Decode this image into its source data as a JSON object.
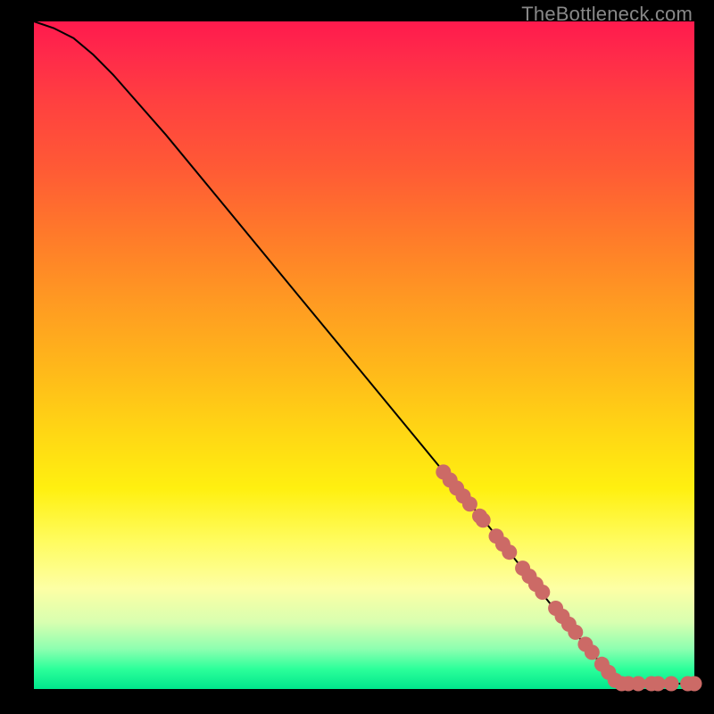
{
  "watermark": "TheBottleneck.com",
  "chart_data": {
    "type": "line",
    "title": "",
    "xlabel": "",
    "ylabel": "",
    "xlim": [
      0,
      100
    ],
    "ylim": [
      0,
      100
    ],
    "grid": false,
    "series": [
      {
        "name": "curve",
        "style": "line-black",
        "points": [
          {
            "x": 0,
            "y": 100
          },
          {
            "x": 3,
            "y": 99
          },
          {
            "x": 6,
            "y": 97.5
          },
          {
            "x": 9,
            "y": 95
          },
          {
            "x": 12,
            "y": 92
          },
          {
            "x": 20,
            "y": 83
          },
          {
            "x": 30,
            "y": 71
          },
          {
            "x": 40,
            "y": 59
          },
          {
            "x": 50,
            "y": 47
          },
          {
            "x": 60,
            "y": 35
          },
          {
            "x": 70,
            "y": 23
          },
          {
            "x": 78,
            "y": 13
          },
          {
            "x": 84,
            "y": 6
          },
          {
            "x": 88,
            "y": 1.2
          },
          {
            "x": 89,
            "y": 0.8
          },
          {
            "x": 100,
            "y": 0.8
          }
        ]
      },
      {
        "name": "highlight-dots",
        "style": "dots-salmon",
        "points": [
          {
            "x": 62,
            "y": 32.5
          },
          {
            "x": 63,
            "y": 31.3
          },
          {
            "x": 64,
            "y": 30.1
          },
          {
            "x": 65,
            "y": 28.9
          },
          {
            "x": 66,
            "y": 27.7
          },
          {
            "x": 67.5,
            "y": 25.9
          },
          {
            "x": 68,
            "y": 25.3
          },
          {
            "x": 70,
            "y": 22.9
          },
          {
            "x": 71,
            "y": 21.7
          },
          {
            "x": 72,
            "y": 20.5
          },
          {
            "x": 74,
            "y": 18.1
          },
          {
            "x": 75,
            "y": 16.9
          },
          {
            "x": 76,
            "y": 15.7
          },
          {
            "x": 77,
            "y": 14.5
          },
          {
            "x": 79,
            "y": 12.1
          },
          {
            "x": 80,
            "y": 10.9
          },
          {
            "x": 81,
            "y": 9.7
          },
          {
            "x": 82,
            "y": 8.5
          },
          {
            "x": 83.5,
            "y": 6.7
          },
          {
            "x": 84.5,
            "y": 5.5
          },
          {
            "x": 86,
            "y": 3.7
          },
          {
            "x": 87,
            "y": 2.5
          },
          {
            "x": 88,
            "y": 1.3
          },
          {
            "x": 89,
            "y": 0.8
          },
          {
            "x": 90,
            "y": 0.8
          },
          {
            "x": 91.5,
            "y": 0.8
          },
          {
            "x": 93.5,
            "y": 0.8
          },
          {
            "x": 94.5,
            "y": 0.8
          },
          {
            "x": 96.5,
            "y": 0.8
          },
          {
            "x": 99,
            "y": 0.8
          },
          {
            "x": 100,
            "y": 0.8
          }
        ]
      }
    ]
  },
  "colors": {
    "dot": "#cc6a66",
    "line": "#000000"
  }
}
